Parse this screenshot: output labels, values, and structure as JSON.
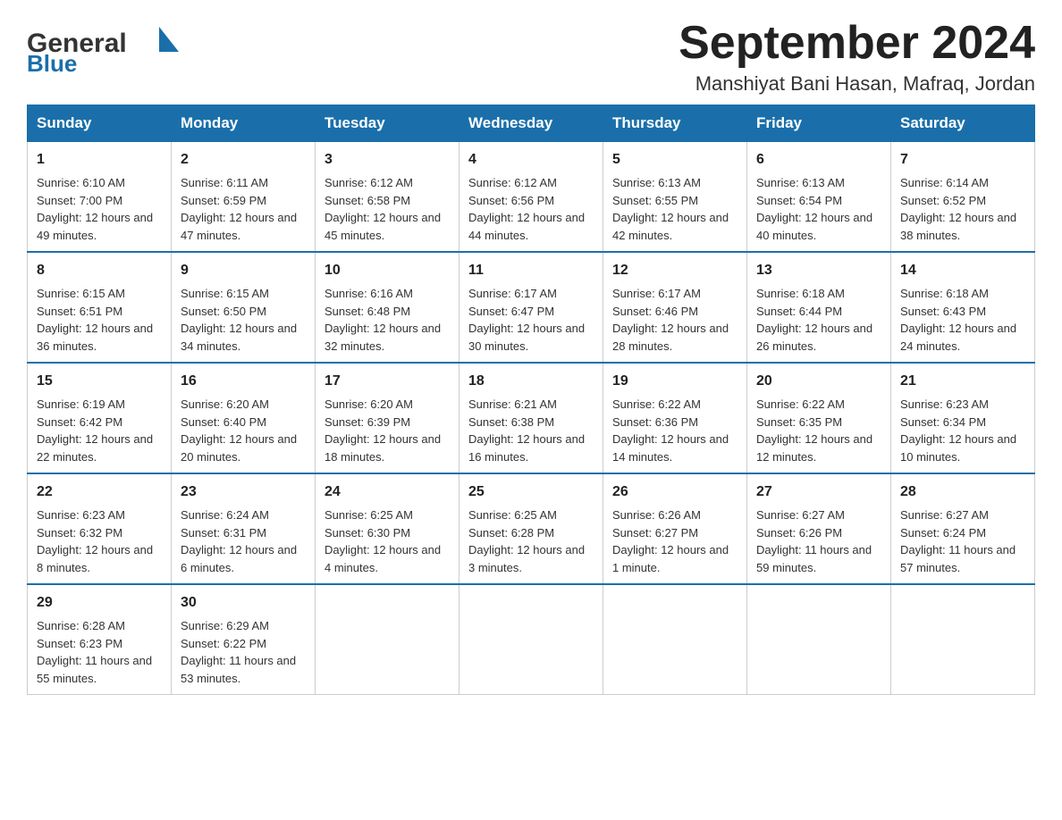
{
  "logo": {
    "general": "General",
    "blue": "Blue"
  },
  "header": {
    "month_year": "September 2024",
    "location": "Manshiyat Bani Hasan, Mafraq, Jordan"
  },
  "weekdays": [
    "Sunday",
    "Monday",
    "Tuesday",
    "Wednesday",
    "Thursday",
    "Friday",
    "Saturday"
  ],
  "weeks": [
    [
      {
        "day": "1",
        "sunrise": "Sunrise: 6:10 AM",
        "sunset": "Sunset: 7:00 PM",
        "daylight": "Daylight: 12 hours and 49 minutes."
      },
      {
        "day": "2",
        "sunrise": "Sunrise: 6:11 AM",
        "sunset": "Sunset: 6:59 PM",
        "daylight": "Daylight: 12 hours and 47 minutes."
      },
      {
        "day": "3",
        "sunrise": "Sunrise: 6:12 AM",
        "sunset": "Sunset: 6:58 PM",
        "daylight": "Daylight: 12 hours and 45 minutes."
      },
      {
        "day": "4",
        "sunrise": "Sunrise: 6:12 AM",
        "sunset": "Sunset: 6:56 PM",
        "daylight": "Daylight: 12 hours and 44 minutes."
      },
      {
        "day": "5",
        "sunrise": "Sunrise: 6:13 AM",
        "sunset": "Sunset: 6:55 PM",
        "daylight": "Daylight: 12 hours and 42 minutes."
      },
      {
        "day": "6",
        "sunrise": "Sunrise: 6:13 AM",
        "sunset": "Sunset: 6:54 PM",
        "daylight": "Daylight: 12 hours and 40 minutes."
      },
      {
        "day": "7",
        "sunrise": "Sunrise: 6:14 AM",
        "sunset": "Sunset: 6:52 PM",
        "daylight": "Daylight: 12 hours and 38 minutes."
      }
    ],
    [
      {
        "day": "8",
        "sunrise": "Sunrise: 6:15 AM",
        "sunset": "Sunset: 6:51 PM",
        "daylight": "Daylight: 12 hours and 36 minutes."
      },
      {
        "day": "9",
        "sunrise": "Sunrise: 6:15 AM",
        "sunset": "Sunset: 6:50 PM",
        "daylight": "Daylight: 12 hours and 34 minutes."
      },
      {
        "day": "10",
        "sunrise": "Sunrise: 6:16 AM",
        "sunset": "Sunset: 6:48 PM",
        "daylight": "Daylight: 12 hours and 32 minutes."
      },
      {
        "day": "11",
        "sunrise": "Sunrise: 6:17 AM",
        "sunset": "Sunset: 6:47 PM",
        "daylight": "Daylight: 12 hours and 30 minutes."
      },
      {
        "day": "12",
        "sunrise": "Sunrise: 6:17 AM",
        "sunset": "Sunset: 6:46 PM",
        "daylight": "Daylight: 12 hours and 28 minutes."
      },
      {
        "day": "13",
        "sunrise": "Sunrise: 6:18 AM",
        "sunset": "Sunset: 6:44 PM",
        "daylight": "Daylight: 12 hours and 26 minutes."
      },
      {
        "day": "14",
        "sunrise": "Sunrise: 6:18 AM",
        "sunset": "Sunset: 6:43 PM",
        "daylight": "Daylight: 12 hours and 24 minutes."
      }
    ],
    [
      {
        "day": "15",
        "sunrise": "Sunrise: 6:19 AM",
        "sunset": "Sunset: 6:42 PM",
        "daylight": "Daylight: 12 hours and 22 minutes."
      },
      {
        "day": "16",
        "sunrise": "Sunrise: 6:20 AM",
        "sunset": "Sunset: 6:40 PM",
        "daylight": "Daylight: 12 hours and 20 minutes."
      },
      {
        "day": "17",
        "sunrise": "Sunrise: 6:20 AM",
        "sunset": "Sunset: 6:39 PM",
        "daylight": "Daylight: 12 hours and 18 minutes."
      },
      {
        "day": "18",
        "sunrise": "Sunrise: 6:21 AM",
        "sunset": "Sunset: 6:38 PM",
        "daylight": "Daylight: 12 hours and 16 minutes."
      },
      {
        "day": "19",
        "sunrise": "Sunrise: 6:22 AM",
        "sunset": "Sunset: 6:36 PM",
        "daylight": "Daylight: 12 hours and 14 minutes."
      },
      {
        "day": "20",
        "sunrise": "Sunrise: 6:22 AM",
        "sunset": "Sunset: 6:35 PM",
        "daylight": "Daylight: 12 hours and 12 minutes."
      },
      {
        "day": "21",
        "sunrise": "Sunrise: 6:23 AM",
        "sunset": "Sunset: 6:34 PM",
        "daylight": "Daylight: 12 hours and 10 minutes."
      }
    ],
    [
      {
        "day": "22",
        "sunrise": "Sunrise: 6:23 AM",
        "sunset": "Sunset: 6:32 PM",
        "daylight": "Daylight: 12 hours and 8 minutes."
      },
      {
        "day": "23",
        "sunrise": "Sunrise: 6:24 AM",
        "sunset": "Sunset: 6:31 PM",
        "daylight": "Daylight: 12 hours and 6 minutes."
      },
      {
        "day": "24",
        "sunrise": "Sunrise: 6:25 AM",
        "sunset": "Sunset: 6:30 PM",
        "daylight": "Daylight: 12 hours and 4 minutes."
      },
      {
        "day": "25",
        "sunrise": "Sunrise: 6:25 AM",
        "sunset": "Sunset: 6:28 PM",
        "daylight": "Daylight: 12 hours and 3 minutes."
      },
      {
        "day": "26",
        "sunrise": "Sunrise: 6:26 AM",
        "sunset": "Sunset: 6:27 PM",
        "daylight": "Daylight: 12 hours and 1 minute."
      },
      {
        "day": "27",
        "sunrise": "Sunrise: 6:27 AM",
        "sunset": "Sunset: 6:26 PM",
        "daylight": "Daylight: 11 hours and 59 minutes."
      },
      {
        "day": "28",
        "sunrise": "Sunrise: 6:27 AM",
        "sunset": "Sunset: 6:24 PM",
        "daylight": "Daylight: 11 hours and 57 minutes."
      }
    ],
    [
      {
        "day": "29",
        "sunrise": "Sunrise: 6:28 AM",
        "sunset": "Sunset: 6:23 PM",
        "daylight": "Daylight: 11 hours and 55 minutes."
      },
      {
        "day": "30",
        "sunrise": "Sunrise: 6:29 AM",
        "sunset": "Sunset: 6:22 PM",
        "daylight": "Daylight: 11 hours and 53 minutes."
      },
      null,
      null,
      null,
      null,
      null
    ]
  ]
}
